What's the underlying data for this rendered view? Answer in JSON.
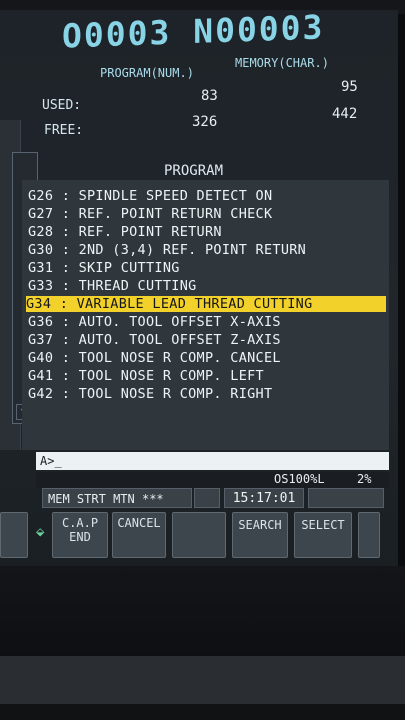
{
  "header": {
    "program_number": "O0003 N00003",
    "program_label": "PROGRAM(NUM.)",
    "memory_label": "MEMORY(CHAR.)",
    "used_label": "USED:",
    "free_label": "FREE:",
    "used_num": "83",
    "used_mem": "95",
    "free_num": "326",
    "free_mem": "442"
  },
  "program": {
    "title": "PROGRAM",
    "lines": [
      "G26 : SPINDLE SPEED DETECT ON",
      "G27 : REF. POINT RETURN CHECK",
      "G28 : REF. POINT RETURN",
      "G30 : 2ND (3,4) REF. POINT RETURN",
      "G31 : SKIP CUTTING",
      "G33 : THREAD CUTTING",
      "G34 : VARIABLE LEAD THREAD CUTTING",
      "G36 : AUTO. TOOL OFFSET X-AXIS",
      "G37 : AUTO. TOOL OFFSET Z-AXIS",
      "G40 : TOOL NOSE R COMP. CANCEL",
      "G41 : TOOL NOSE R COMP. LEFT",
      "G42 : TOOL NOSE R COMP. RIGHT"
    ],
    "selected_index": 6
  },
  "input": {
    "prompt": "A>_"
  },
  "status": {
    "override": "OS100%L",
    "percent": "2%",
    "mode": "MEM",
    "state": "STRT",
    "motion": "MTN",
    "alarm": "***",
    "time": "15:17:01"
  },
  "softkeys": {
    "cap_line1": "C.A.P",
    "cap_line2": "END",
    "cancel": "CANCEL",
    "search": "SEARCH",
    "select": "SELECT"
  },
  "colors": {
    "highlight": "#f2d12a",
    "title_cyan": "#88d3e6"
  }
}
